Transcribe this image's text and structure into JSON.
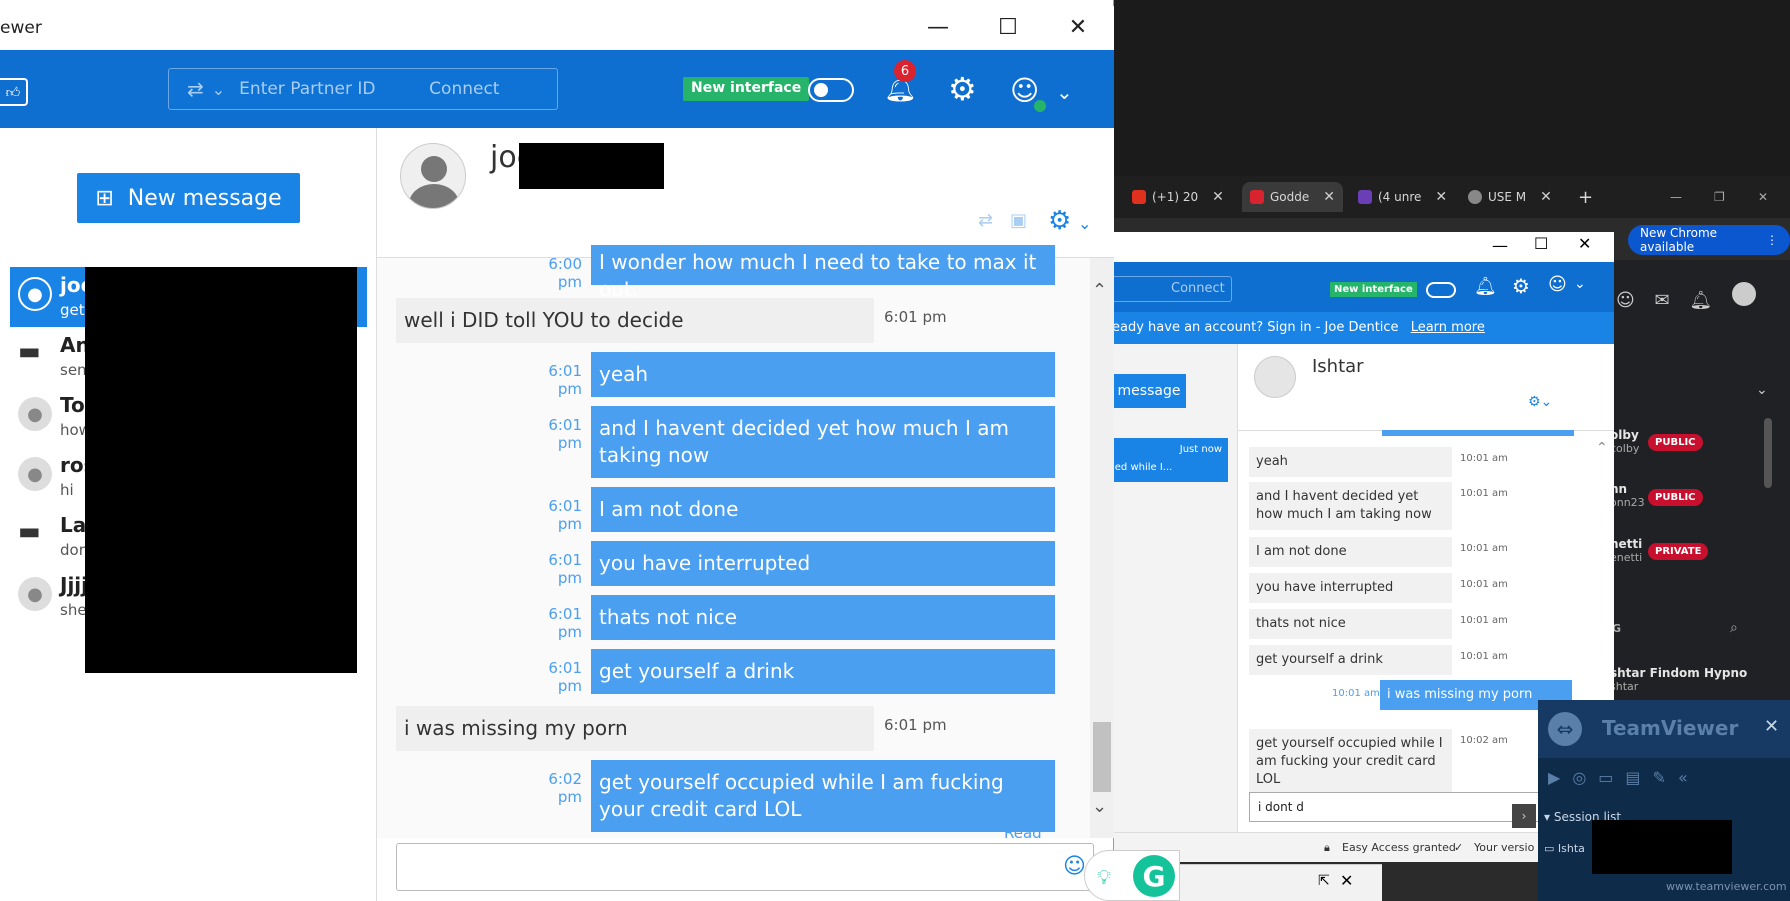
{
  "main_window": {
    "title": "ewer",
    "toolbar": {
      "partner_placeholder": "Enter Partner ID",
      "connect_label": "Connect",
      "new_interface_label": "New interface",
      "notification_count": "6"
    },
    "sidebar": {
      "new_message_label": "New message",
      "conversations": [
        {
          "name": "joe",
          "preview": "get",
          "selected": true,
          "icon": "person-icon"
        },
        {
          "name": "An",
          "preview": "sen",
          "selected": false,
          "icon": "monitor-icon"
        },
        {
          "name": "To",
          "preview": "how",
          "selected": false,
          "icon": "person-icon"
        },
        {
          "name": "ros",
          "preview": "hi",
          "selected": false,
          "icon": "person-icon"
        },
        {
          "name": "Lat",
          "preview": "dor",
          "selected": false,
          "icon": "monitor-icon"
        },
        {
          "name": "Jjjj",
          "preview": "she",
          "selected": false,
          "icon": "person-icon"
        }
      ]
    },
    "chat": {
      "contact_name": "joe",
      "messages": [
        {
          "from": "me",
          "time": "6:00 pm",
          "text": "I wonder how much I need to take to max it out."
        },
        {
          "from": "them",
          "time": "6:01 pm",
          "text": "well i DID toll YOU to decide"
        },
        {
          "from": "me",
          "time": "6:01 pm",
          "text": "yeah"
        },
        {
          "from": "me",
          "time": "6:01 pm",
          "text": "and I havent decided yet how much I am taking now"
        },
        {
          "from": "me",
          "time": "6:01 pm",
          "text": "I am not done"
        },
        {
          "from": "me",
          "time": "6:01 pm",
          "text": "you have interrupted"
        },
        {
          "from": "me",
          "time": "6:01 pm",
          "text": "thats not nice"
        },
        {
          "from": "me",
          "time": "6:01 pm",
          "text": "get yourself a drink"
        },
        {
          "from": "them",
          "time": "6:01 pm",
          "text": "i was missing my porn"
        },
        {
          "from": "me",
          "time": "6:02 pm",
          "text": "get yourself occupied while I am fucking your credit card LOL"
        }
      ],
      "read_label": "Read",
      "composer_value": ""
    }
  },
  "browser": {
    "tabs": [
      {
        "label": "(+1) 20",
        "color": "#e0301e"
      },
      {
        "label": "Godde",
        "color": "#d9232e"
      },
      {
        "label": "(4 unre",
        "color": "#6a3fb5"
      },
      {
        "label": "USE M",
        "color": "#888888"
      }
    ],
    "new_chrome_label": "New Chrome available",
    "models": [
      {
        "name": "olby",
        "handle": "colby",
        "badge": "PUBLIC"
      },
      {
        "name": "nn",
        "handle": "onn23",
        "badge": "PUBLIC"
      },
      {
        "name": "netti",
        "handle": "enetti",
        "badge": "PRIVATE"
      }
    ],
    "section_label": "G",
    "featured": {
      "name": "shtar Findom Hypno",
      "handle": "shtar"
    }
  },
  "second_window": {
    "connect_label": "Connect",
    "new_interface_label": "New interface",
    "info_text": "eady have an account? Sign in - Joe Dentice",
    "learn_more": "Learn more",
    "new_message_label": "message",
    "left_item": {
      "time": "Just now",
      "text": "ied while I..."
    },
    "contact_name": "Ishtar",
    "messages": [
      {
        "from": "them",
        "time": "10:01 am",
        "text": "yeah"
      },
      {
        "from": "them",
        "time": "10:01 am",
        "text": "and I havent decided yet how much I am taking now"
      },
      {
        "from": "them",
        "time": "10:01 am",
        "text": "I am not done"
      },
      {
        "from": "them",
        "time": "10:01 am",
        "text": "you have interrupted"
      },
      {
        "from": "them",
        "time": "10:01 am",
        "text": "thats not nice"
      },
      {
        "from": "them",
        "time": "10:01 am",
        "text": "get yourself a drink"
      },
      {
        "from": "me",
        "time": "10:01 am",
        "text": "i was missing my porn"
      },
      {
        "from": "them",
        "time": "10:02 am",
        "text": "get yourself occupied while I am fucking your credit card LOL"
      }
    ],
    "composer_value": "i dont d",
    "status_access": "Easy Access granted",
    "status_version": "Your versio"
  },
  "tv_panel": {
    "brand": "TeamViewer",
    "session_list_label": "Session list",
    "session_name": "Ishta",
    "url": "www.teamviewer.com"
  },
  "colors": {
    "brand_blue": "#0e6fd0",
    "bubble_blue": "#4a9ff0",
    "new_interface_green": "#25b46a",
    "notif_red": "#d9232e"
  }
}
